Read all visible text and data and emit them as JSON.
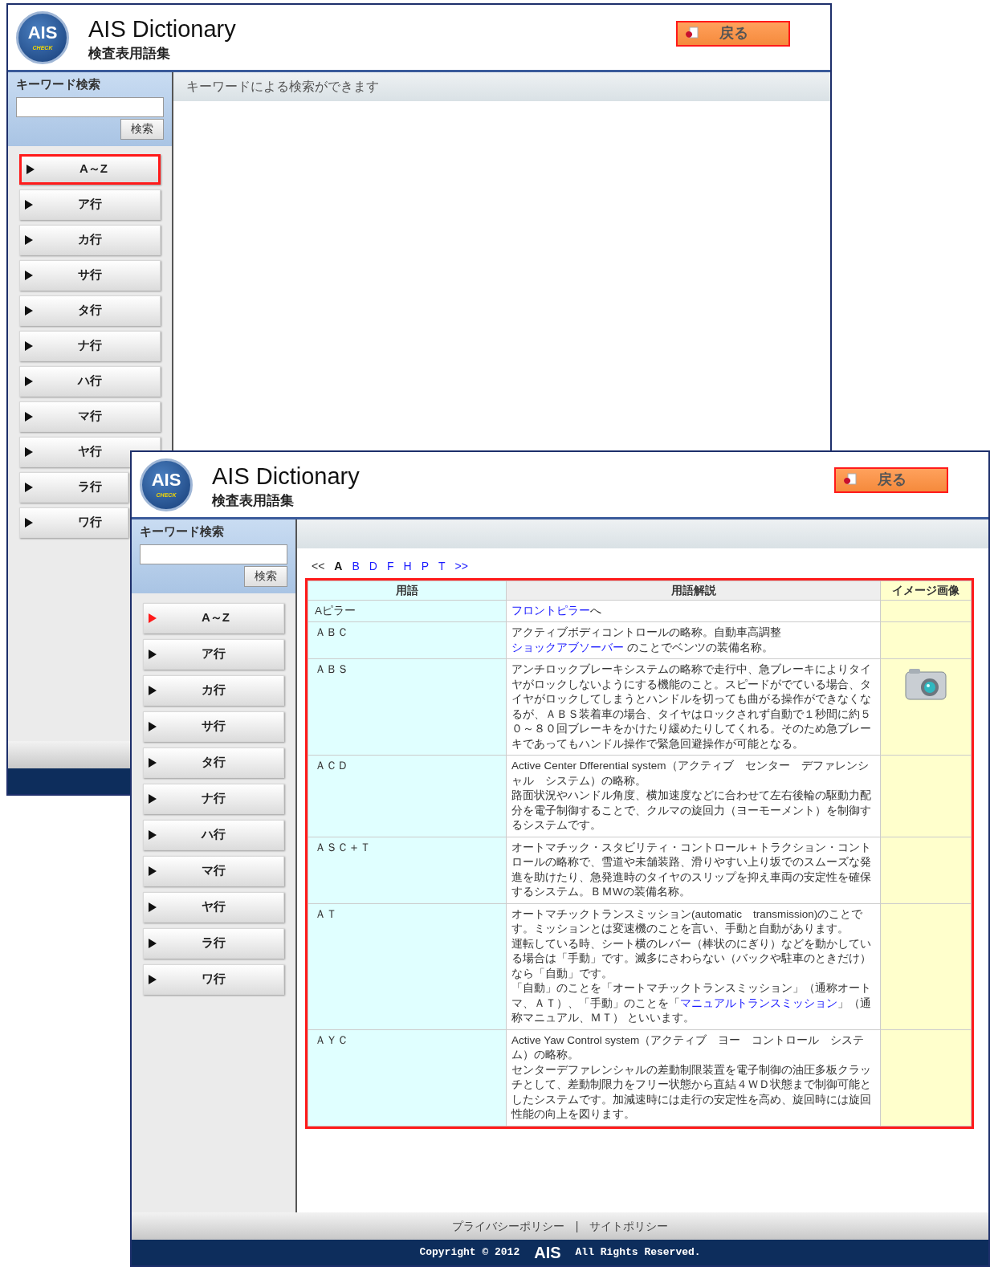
{
  "windows": [
    {
      "logo": {
        "text": "AIS",
        "tagline": "CHECK"
      },
      "title": "AIS Dictionary",
      "subtitle": "検査表用語集",
      "back_button": {
        "label": "戻る",
        "annotated": true
      },
      "search": {
        "label": "キーワード検索",
        "button": "検索"
      },
      "sidebar": {
        "items": [
          {
            "label": "A～Z",
            "selected": false,
            "annotated": true
          },
          {
            "label": "ア行",
            "selected": false,
            "annotated": false
          },
          {
            "label": "カ行",
            "selected": false,
            "annotated": false
          },
          {
            "label": "サ行",
            "selected": false,
            "annotated": false
          },
          {
            "label": "タ行",
            "selected": false,
            "annotated": false
          },
          {
            "label": "ナ行",
            "selected": false,
            "annotated": false
          },
          {
            "label": "ハ行",
            "selected": false,
            "annotated": false
          },
          {
            "label": "マ行",
            "selected": false,
            "annotated": false
          },
          {
            "label": "ヤ行",
            "selected": false,
            "annotated": false
          },
          {
            "label": "ラ行",
            "selected": false,
            "annotated": false
          },
          {
            "label": "ワ行",
            "selected": false,
            "annotated": false
          }
        ]
      },
      "content": {
        "heading": "キーワードによる検索ができます"
      }
    },
    {
      "logo": {
        "text": "AIS",
        "tagline": "CHECK"
      },
      "title": "AIS Dictionary",
      "subtitle": "検査表用語集",
      "back_button": {
        "label": "戻る",
        "annotated": true
      },
      "search": {
        "label": "キーワード検索",
        "button": "検索"
      },
      "sidebar": {
        "items": [
          {
            "label": "A～Z",
            "selected": true,
            "annotated": false
          },
          {
            "label": "ア行",
            "selected": false,
            "annotated": false
          },
          {
            "label": "カ行",
            "selected": false,
            "annotated": false
          },
          {
            "label": "サ行",
            "selected": false,
            "annotated": false
          },
          {
            "label": "タ行",
            "selected": false,
            "annotated": false
          },
          {
            "label": "ナ行",
            "selected": false,
            "annotated": false
          },
          {
            "label": "ハ行",
            "selected": false,
            "annotated": false
          },
          {
            "label": "マ行",
            "selected": false,
            "annotated": false
          },
          {
            "label": "ヤ行",
            "selected": false,
            "annotated": false
          },
          {
            "label": "ラ行",
            "selected": false,
            "annotated": false
          },
          {
            "label": "ワ行",
            "selected": false,
            "annotated": false
          }
        ]
      },
      "content": {
        "alpha_nav": [
          {
            "label": "<<",
            "selected": false,
            "disabled": true
          },
          {
            "label": "A",
            "selected": true,
            "disabled": false
          },
          {
            "label": "B",
            "selected": false,
            "disabled": false
          },
          {
            "label": "D",
            "selected": false,
            "disabled": false
          },
          {
            "label": "F",
            "selected": false,
            "disabled": false
          },
          {
            "label": "H",
            "selected": false,
            "disabled": false
          },
          {
            "label": "P",
            "selected": false,
            "disabled": false
          },
          {
            "label": "T",
            "selected": false,
            "disabled": false
          },
          {
            "label": ">>",
            "selected": false,
            "disabled": false
          }
        ],
        "table": {
          "annotated": true,
          "columns": [
            "用語",
            "用語解説",
            "イメージ画像"
          ],
          "rows": [
            {
              "term": "Aピラー",
              "has_image": false,
              "description": [
                [
                  {
                    "text": "フロントピラー",
                    "link": true
                  },
                  {
                    "text": "へ",
                    "link": false
                  }
                ]
              ]
            },
            {
              "term": "ＡＢＣ",
              "has_image": false,
              "description": [
                [
                  {
                    "text": "アクティブボディコントロールの略称。自動車高調整",
                    "link": false
                  },
                  {
                    "text": "ショックアブソーバー",
                    "link": true
                  },
                  {
                    "text": " のことでベンツの装備名称。",
                    "link": false
                  }
                ]
              ]
            },
            {
              "term": "ＡＢＳ",
              "has_image": true,
              "description": [
                [
                  {
                    "text": "アンチロックブレーキシステムの略称で走行中、急ブレーキによりタイヤがロックしないようにする機能のこと。スピードがでている場合、タイヤがロックしてしまうとハンドルを切っても曲がる操作ができなくなるが、ＡＢＳ装着車の場合、タイヤはロックされず自動で１秒間に約５０～８０回ブレーキをかけたり緩めたりしてくれる。そのため急ブレーキであってもハンドル操作で緊急回避操作が可能となる。",
                    "link": false
                  }
                ]
              ]
            },
            {
              "term": "ＡＣＤ",
              "has_image": false,
              "description": [
                [
                  {
                    "text": "Active Center Dfferential system（アクティブ　センター　デファレンシャル　システム）の略称。",
                    "link": false
                  }
                ],
                [
                  {
                    "text": "路面状況やハンドル角度、横加速度などに合わせて左右後輪の駆動力配分を電子制御することで、クルマの旋回力（ヨーモーメント）を制御するシステムです。",
                    "link": false
                  }
                ]
              ]
            },
            {
              "term": "ＡＳＣ＋Ｔ",
              "has_image": false,
              "description": [
                [
                  {
                    "text": "オートマチック・スタビリティ・コントロール＋トラクション・コントロールの略称で、雪道や未舗装路、滑りやすい上り坂でのスムーズな発進を助けたり、急発進時のタイヤのスリップを抑え車両の安定性を確保するシステム。ＢＭWの装備名称。",
                    "link": false
                  }
                ]
              ]
            },
            {
              "term": "ＡＴ",
              "has_image": false,
              "description": [
                [
                  {
                    "text": "オートマチックトランスミッション(automatic　transmission)のことです。ミッションとは変速機のことを言い、手動と自動があります。",
                    "link": false
                  }
                ],
                [
                  {
                    "text": "運転している時、シート横のレバー（棒状のにぎり）などを動かしている場合は「手動」です。滅多にさわらない（バックや駐車のときだけ）なら「自動」です。",
                    "link": false
                  }
                ],
                [
                  {
                    "text": "「自動」のことを「オートマチックトランスミッション」（通称オートマ、ＡＴ）、「手動」のことを「",
                    "link": false
                  },
                  {
                    "text": "マニュアルトランスミッション",
                    "link": true
                  },
                  {
                    "text": "」（通称マニュアル、ＭＴ） といいます。",
                    "link": false
                  }
                ]
              ]
            },
            {
              "term": "ＡＹＣ",
              "has_image": false,
              "description": [
                [
                  {
                    "text": "Active Yaw Control system（アクティブ　ヨー　コントロール　システム）の略称。",
                    "link": false
                  }
                ],
                [
                  {
                    "text": "センターデファレンシャルの差動制限装置を電子制御の油圧多板クラッチとして、差動制限力をフリー状態から直結４ＷＤ状態まで制御可能としたシステムです。加減速時には走行の安定性を高め、旋回時には旋回性能の向上を図ります。",
                    "link": false
                  }
                ]
              ]
            }
          ]
        }
      },
      "footer": {
        "links": [
          {
            "label": "プライバシーポリシー"
          },
          {
            "label": "サイトポリシー"
          }
        ],
        "separator": "|",
        "copyright": "Copyright © 2012",
        "brand": "AIS",
        "rights": "All Rights Reserved."
      }
    }
  ]
}
